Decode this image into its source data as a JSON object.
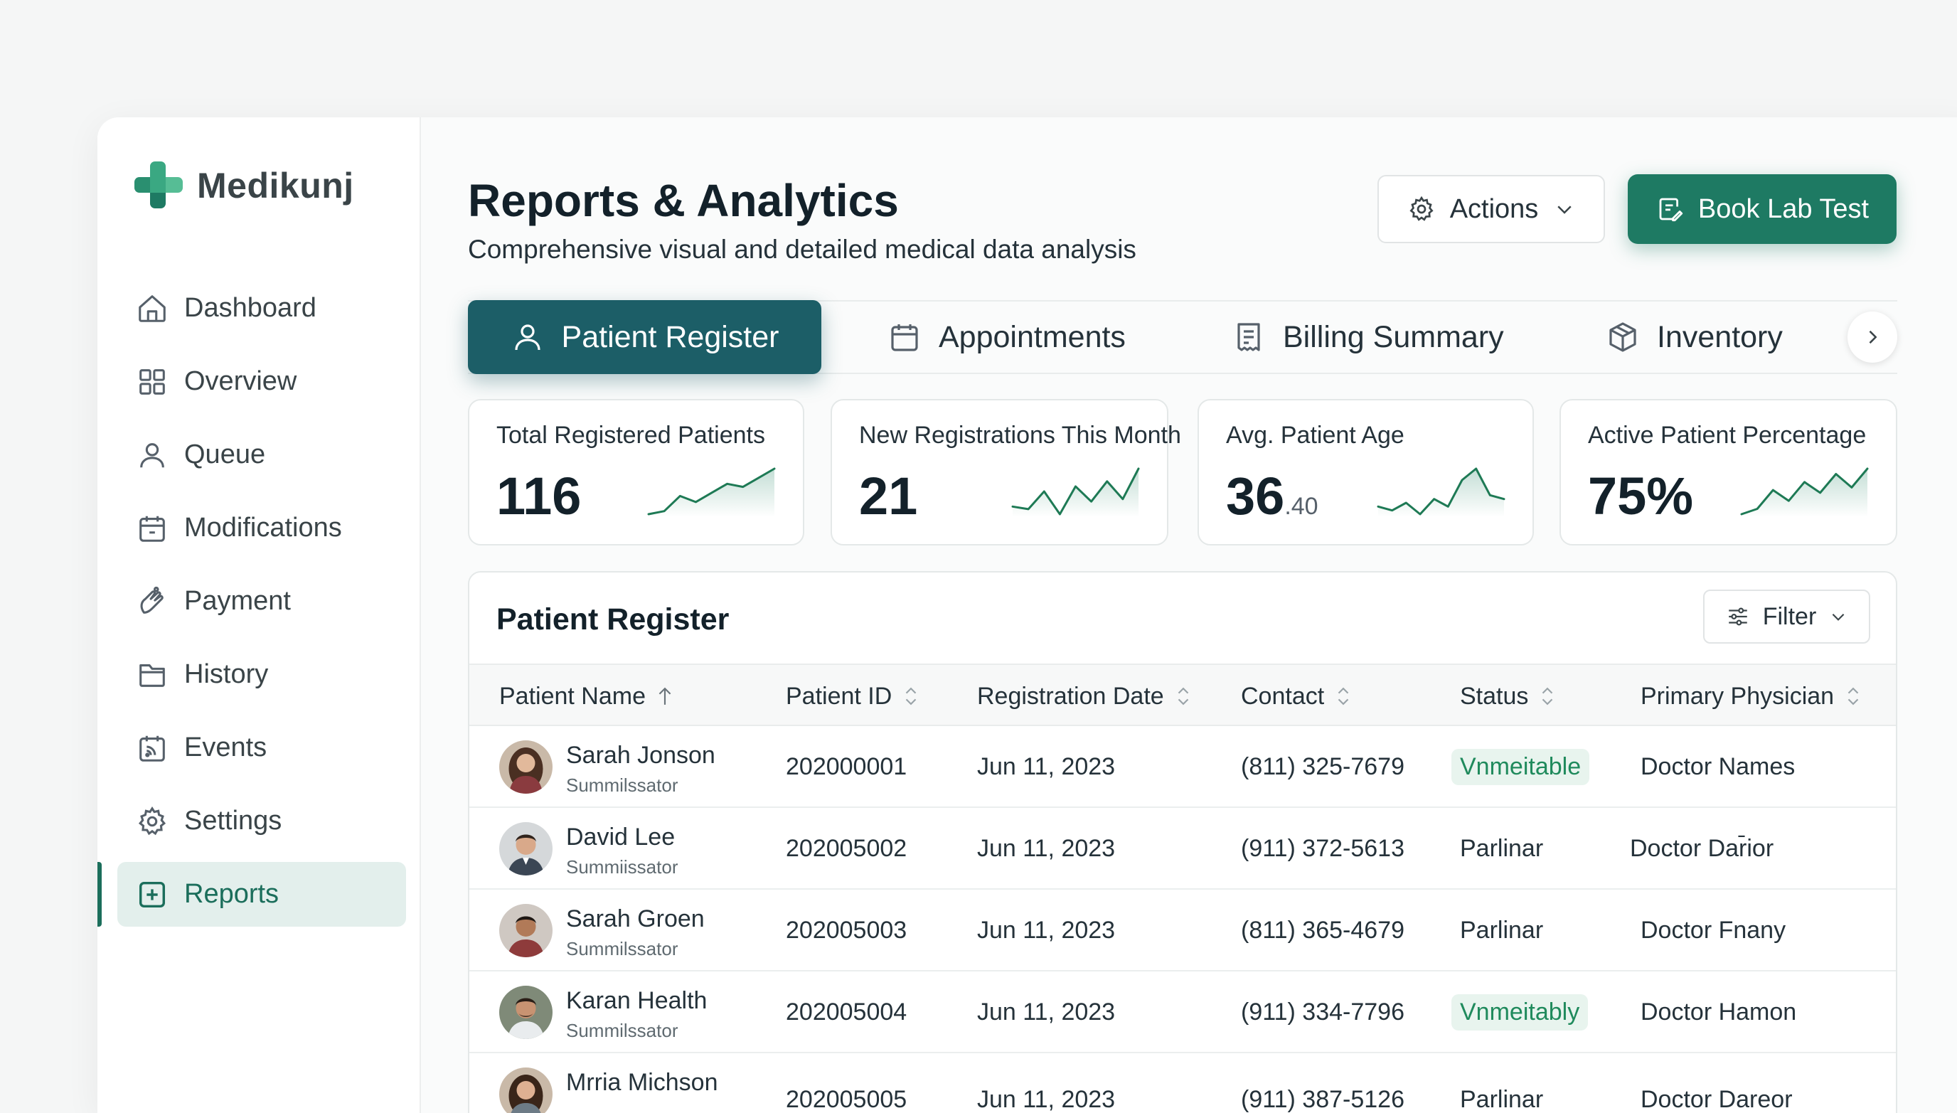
{
  "app": {
    "name": "Medikunj",
    "brand_color": "#1e7a63",
    "accent_color": "#1c5e67"
  },
  "sidebar": {
    "items": [
      {
        "label": "Dashboard",
        "icon": "home-icon"
      },
      {
        "label": "Overview",
        "icon": "grid-icon"
      },
      {
        "label": "Queue",
        "icon": "user-icon"
      },
      {
        "label": "Modifications",
        "icon": "calendar-icon"
      },
      {
        "label": "Payment",
        "icon": "hand-icon"
      },
      {
        "label": "History",
        "icon": "folder-icon"
      },
      {
        "label": "Events",
        "icon": "rss-calendar-icon"
      },
      {
        "label": "Settings",
        "icon": "gear-icon"
      },
      {
        "label": "Reports",
        "icon": "plus-square-icon",
        "active": true
      }
    ]
  },
  "header": {
    "title": "Reports & Analytics",
    "subtitle": "Comprehensive visual and detailed medical data analysis",
    "actions_label": "Actions",
    "book_label": "Book Lab Test"
  },
  "tabs": [
    {
      "label": "Patient Register",
      "icon": "user-icon",
      "active": true
    },
    {
      "label": "Appointments",
      "icon": "calendar-icon"
    },
    {
      "label": "Billing Summary",
      "icon": "receipt-icon"
    },
    {
      "label": "Inventory",
      "icon": "box-icon"
    }
  ],
  "stats": [
    {
      "label": "Total Registered Patients",
      "value": "116",
      "trend": [
        10,
        12,
        22,
        18,
        24,
        30,
        28,
        34,
        40
      ]
    },
    {
      "label": "New Registrations This Month",
      "value": "21",
      "trend": [
        14,
        12,
        26,
        8,
        30,
        18,
        34,
        20,
        44
      ]
    },
    {
      "label": "Avg. Patient Age",
      "value": "36",
      "value_suffix": ".40",
      "trend": [
        20,
        18,
        22,
        16,
        24,
        20,
        34,
        40,
        26,
        24
      ]
    },
    {
      "label": "Active Patient Percentage",
      "value": "75%",
      "trend": [
        8,
        12,
        26,
        18,
        32,
        24,
        38,
        28,
        42
      ]
    }
  ],
  "table": {
    "title": "Patient Register",
    "filter_label": "Filter",
    "columns": [
      "Patient Name",
      "Patient ID",
      "Registration Date",
      "Contact",
      "Status",
      "Primary Physician"
    ],
    "rows": [
      {
        "name": "Sarah Jonson",
        "role": "Summilssator",
        "id": "202000001",
        "date": "Jun 11, 2023",
        "contact": "(811) 325-7679",
        "status": "Vnmeitable",
        "status_highlight": true,
        "physician": "Doctor Names"
      },
      {
        "name": "David Lee",
        "role": "Summiissator",
        "id": "202005002",
        "date": "Jun 11, 2023",
        "contact": "(911) 372-5613",
        "status": "Parlinar",
        "status_highlight": false,
        "physician": "Doctor Dar̄ior"
      },
      {
        "name": "Sarah Groen",
        "role": "Summilssator",
        "id": "202005003",
        "date": "Jun 11, 2023",
        "contact": "(811) 365-4679",
        "status": "Parlinar",
        "status_highlight": false,
        "physician": "Doctor Fnany"
      },
      {
        "name": "Karan Health",
        "role": "Summilssator",
        "id": "202005004",
        "date": "Jun 11, 2023",
        "contact": "(911) 334-7796",
        "status": "Vnmeitably",
        "status_highlight": true,
        "physician": "Doctor Hamon"
      },
      {
        "name": "Mrria Michson",
        "role": "",
        "id": "202005005",
        "date": "Jun 11, 2023",
        "contact": "(911) 387-5126",
        "status": "Parlinar",
        "status_highlight": false,
        "physician": "Doctor Dareor"
      }
    ]
  }
}
